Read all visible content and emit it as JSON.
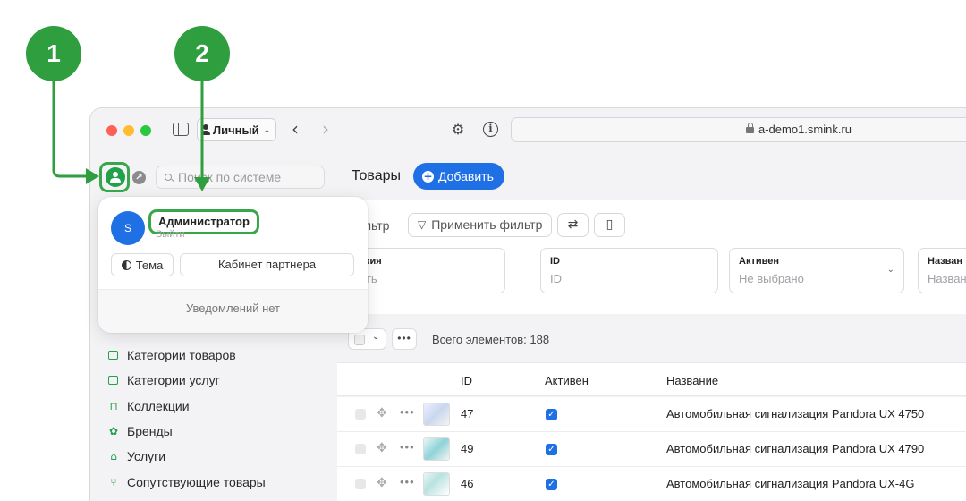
{
  "callouts": {
    "one": "1",
    "two": "2"
  },
  "browser": {
    "profile_label": "Личный",
    "url": "a-demo1.smink.ru"
  },
  "sidebar": {
    "search_placeholder": "Поиск по системе",
    "items": [
      {
        "label": "Категории товаров",
        "icon": "folder-icon"
      },
      {
        "label": "Категории услуг",
        "icon": "folder-icon"
      },
      {
        "label": "Коллекции",
        "icon": "bag-icon"
      },
      {
        "label": "Бренды",
        "icon": "badge-icon"
      },
      {
        "label": "Услуги",
        "icon": "house-icon"
      },
      {
        "label": "Сопутствующие товары",
        "icon": "branch-icon"
      }
    ]
  },
  "header": {
    "title": "Товары",
    "add_label": "Добавить"
  },
  "filters": {
    "filter_label": "ильтр",
    "apply_label": "Применить фильтр",
    "fields": [
      {
        "label": "атегория",
        "value": "ыбрать"
      },
      {
        "label": "ID",
        "value": "ID"
      },
      {
        "label": "Активен",
        "value": "Не выбрано"
      },
      {
        "label": "Назван",
        "value": "Назван"
      }
    ]
  },
  "table": {
    "total": "Всего элементов: 188",
    "columns": [
      "ID",
      "Активен",
      "Название"
    ],
    "rows": [
      {
        "id": "47",
        "active": true,
        "name": "Автомобильная сигнализация Pandora UX 4750"
      },
      {
        "id": "49",
        "active": true,
        "name": "Автомобильная сигнализация Pandora UX 4790"
      },
      {
        "id": "46",
        "active": true,
        "name": "Автомобильная сигнализация Pandora UX-4G"
      }
    ]
  },
  "popup": {
    "avatar_letter": "S",
    "user_name": "Администратор",
    "logout": "Выйти",
    "theme_label": "Тема",
    "partner_label": "Кабинет партнера",
    "notifications": "Уведомлений нет"
  },
  "colors": {
    "accent": "#1f6fe5",
    "callout": "#2f9e3e",
    "highlight": "#3aa64a"
  }
}
